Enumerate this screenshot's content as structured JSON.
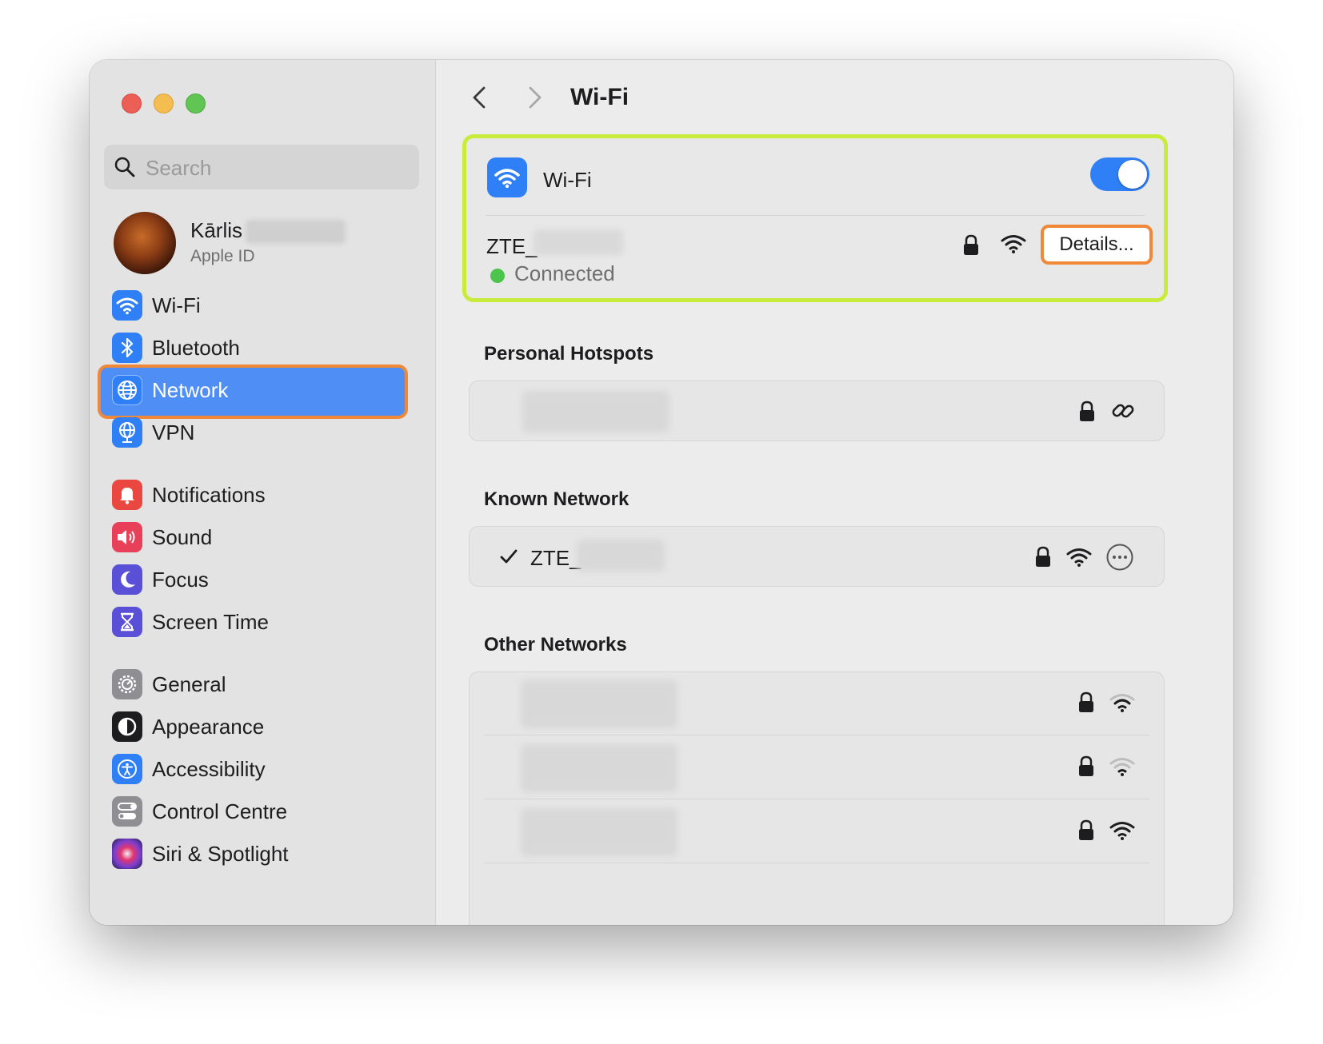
{
  "window": {
    "title": "Wi-Fi"
  },
  "sidebar": {
    "search_placeholder": "Search",
    "account": {
      "name": "Kārlis",
      "subtitle": "Apple ID"
    },
    "items": [
      {
        "label": "Wi-Fi",
        "icon": "wifi-icon",
        "color": "#2f7ff6"
      },
      {
        "label": "Bluetooth",
        "icon": "bluetooth-icon",
        "color": "#2f7ff6"
      },
      {
        "label": "Network",
        "icon": "globe-icon",
        "color": "#2f7ff6",
        "selected": true
      },
      {
        "label": "VPN",
        "icon": "vpn-globe-icon",
        "color": "#2f7ff6"
      },
      {
        "label": "Notifications",
        "icon": "bell-icon",
        "color": "#e9473f"
      },
      {
        "label": "Sound",
        "icon": "speaker-icon",
        "color": "#e9405a"
      },
      {
        "label": "Focus",
        "icon": "moon-icon",
        "color": "#5a50d8"
      },
      {
        "label": "Screen Time",
        "icon": "hourglass-icon",
        "color": "#5a50d8"
      },
      {
        "label": "General",
        "icon": "gear-icon",
        "color": "#8e8e93"
      },
      {
        "label": "Appearance",
        "icon": "appearance-icon",
        "color": "#1d1d1f"
      },
      {
        "label": "Accessibility",
        "icon": "accessibility-icon",
        "color": "#2f7ff6"
      },
      {
        "label": "Control Centre",
        "icon": "control-centre-icon",
        "color": "#8e8e93"
      },
      {
        "label": "Siri & Spotlight",
        "icon": "siri-icon",
        "color": "#7b3fd0"
      }
    ]
  },
  "main": {
    "title": "Wi-Fi",
    "wifi": {
      "label": "Wi-Fi",
      "enabled": true,
      "current_network": "ZTE_",
      "status": "Connected",
      "details_button": "Details..."
    },
    "personal_hotspots": {
      "title": "Personal Hotspots"
    },
    "known_network": {
      "title": "Known Network",
      "network": "ZTE_",
      "checked": true
    },
    "other_networks": {
      "title": "Other Networks",
      "rows": 3
    }
  },
  "colors": {
    "accent": "#2f7ff6",
    "highlight_green": "#c9ec3c",
    "highlight_orange": "#f0883a",
    "status_green": "#4cc54c"
  }
}
